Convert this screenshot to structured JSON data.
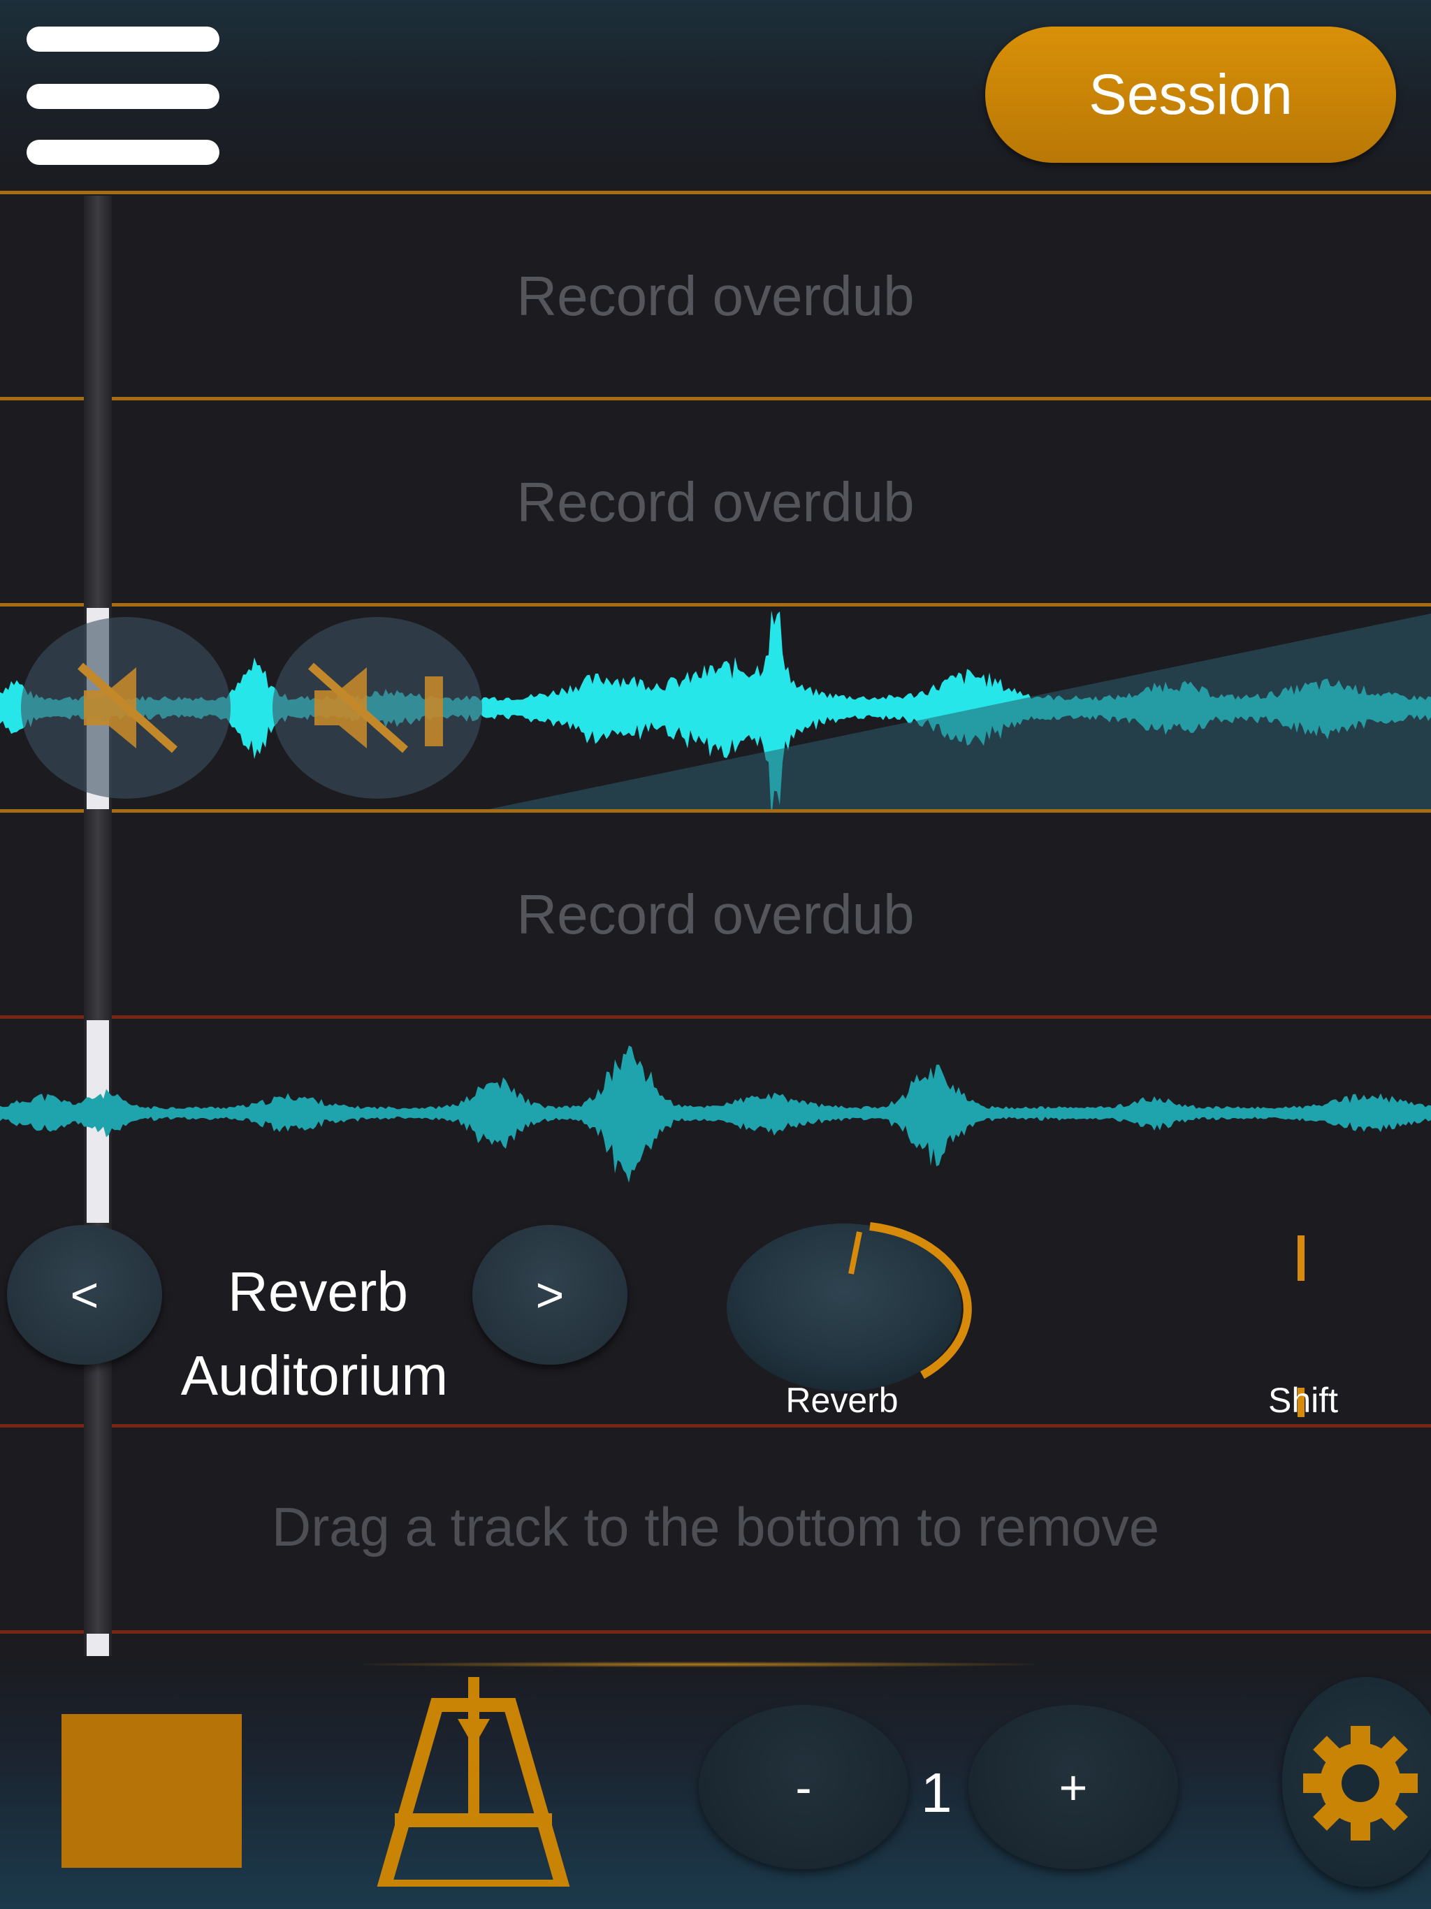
{
  "header": {
    "menu_icon": "hamburger-menu-icon",
    "session_label": "Session"
  },
  "tracks": [
    {
      "type": "empty",
      "label": "Record overdub"
    },
    {
      "type": "empty",
      "label": "Record overdub"
    },
    {
      "type": "recorded",
      "waveform_color": "#27e6e9",
      "mute_icon": "speaker-muted-icon",
      "solo_icon": "speaker-solo-icon"
    },
    {
      "type": "empty",
      "label": "Record overdub"
    },
    {
      "type": "recorded",
      "waveform_color": "#1fa3ad"
    }
  ],
  "effect_panel": {
    "prev_label": "<",
    "next_label": ">",
    "effect_type": "Reverb",
    "effect_preset": "Auditorium",
    "knobs": [
      {
        "label": "Reverb",
        "icon": "rotary-knob-icon"
      },
      {
        "label": "Shift",
        "icon": "slider-icon"
      }
    ]
  },
  "remove_hint": "Drag a track to the bottom to remove",
  "toolbar": {
    "stop_icon": "stop-square-icon",
    "metronome_icon": "metronome-icon",
    "decrement_label": "-",
    "count": "1",
    "increment_label": "+",
    "settings_icon": "gear-icon"
  },
  "colors": {
    "accent": "#c98406",
    "separator": "#a66d12",
    "background": "#1b1b20",
    "waveform_active": "#27e6e9",
    "waveform": "#1fa3ad"
  }
}
